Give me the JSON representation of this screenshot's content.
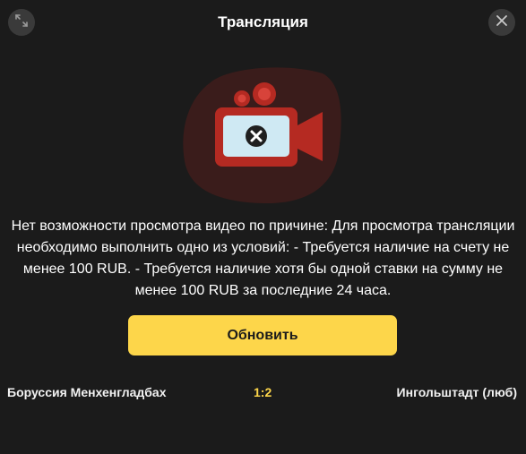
{
  "header": {
    "title": "Трансляция",
    "expand_icon": "expand-icon",
    "close_icon": "close-icon"
  },
  "illustration": {
    "icon": "video-camera-error-icon",
    "colors": {
      "blob": "#3a1c1b",
      "camera": "#b52a22",
      "screen": "#cfe9f3"
    }
  },
  "message": {
    "text": "Нет возможности просмотра видео по причине: Для просмотра трансляции необходимо выполнить одно из условий: - Требуется наличие на счету не менее 100 RUB. - Требуется наличие хотя бы одной ставки на сумму не менее 100 RUB за последние 24 часа."
  },
  "actions": {
    "refresh_label": "Обновить"
  },
  "match": {
    "home_team": "Боруссия Менхенгладбах",
    "score": "1:2",
    "away_team": "Ингольштадт (люб)"
  },
  "colors": {
    "background": "#1b1b1b",
    "accent": "#fdd64a",
    "button_bg": "#3a3a3a"
  }
}
